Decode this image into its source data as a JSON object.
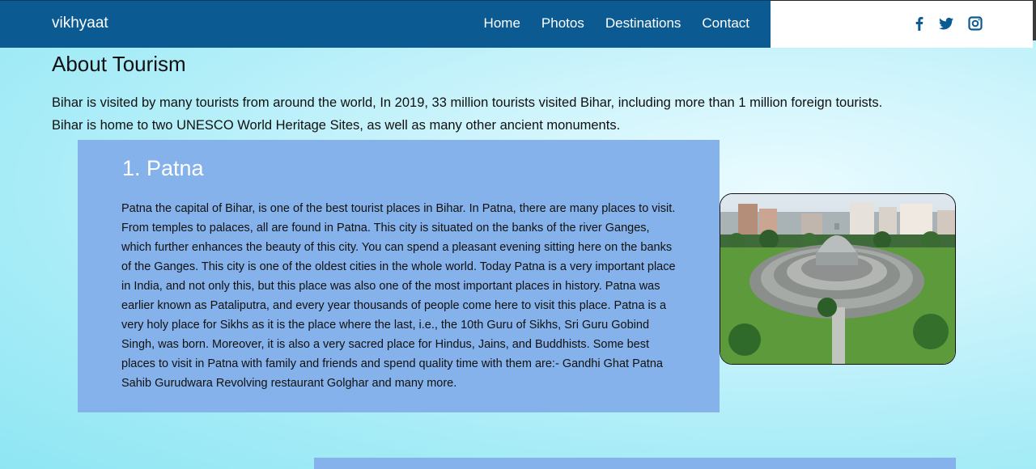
{
  "navbar": {
    "brand": "vikhyaat",
    "links": [
      "Home",
      "Photos",
      "Destinations",
      "Contact"
    ]
  },
  "social": {
    "icons": [
      "facebook-icon",
      "twitter-icon",
      "instagram-icon"
    ]
  },
  "page": {
    "title": "About Tourism",
    "intro": "Bihar is visited by many tourists from around the world, In 2019, 33 million tourists visited Bihar, including more than 1 million foreign tourists. Bihar is home to two UNESCO World Heritage Sites, as well as many other ancient monuments."
  },
  "destinations": [
    {
      "title": "1. Patna",
      "text": "Patna the capital of Bihar, is one of the best tourist places in Bihar. In Patna, there are many places to visit. From temples to palaces, all are found in Patna. This city is situated on the banks of the river Ganges, which further enhances the beauty of this city. You can spend a pleasant evening sitting here on the banks of the Ganges. This city is one of the oldest cities in the whole world. Today Patna is a very important place in India, and not only this, but this place was also one of the most important places in history. Patna was earlier known as Pataliputra, and every year thousands of people come here to visit this place. Patna is a very holy place for Sikhs as it is the place where the last, i.e., the 10th Guru of Sikhs, Sri Guru Gobind Singh, was born. Moreover, it is also a very sacred place for Hindus, Jains, and Buddhists. Some best places to visit in Patna with family and friends and spend quality time with them are:- Gandhi Ghat Patna Sahib Gurudwara Revolving restaurant Golghar and many more."
    }
  ],
  "colors": {
    "navbar": "#0b5a92",
    "card": "#85b2ea",
    "social_icon": "#0b5a92"
  }
}
